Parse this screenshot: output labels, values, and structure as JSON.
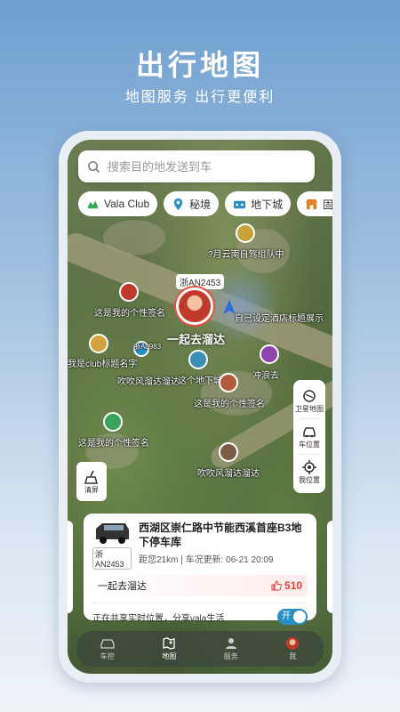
{
  "promo": {
    "title": "出行地图",
    "subtitle": "地图服务  出行更便利"
  },
  "search": {
    "placeholder": "搜索目的地发送到车"
  },
  "chips": [
    {
      "label": "Vala Club",
      "icon": "vala-club-icon",
      "color": "#2fa84f"
    },
    {
      "label": "秘境",
      "icon": "location-pin-icon",
      "color": "#2a8fc4"
    },
    {
      "label": "地下城",
      "icon": "underground-icon",
      "color": "#2a8fc4"
    },
    {
      "label": "固定",
      "icon": "store-icon",
      "color": "#e67e22"
    }
  ],
  "map": {
    "labels": [
      "?月云南自驾组队中",
      "这是我的个性签名",
      "一起去溜达",
      "自己设定酒店标题展示",
      "我是club标题名字",
      "吹吹风溜达溜达",
      "这个地下城",
      "冲浪去",
      "这是我的个性签名",
      "这是我的个性签名",
      "吹吹风溜达溜达"
    ],
    "plates": [
      "浙AN2453",
      "浙A0983"
    ],
    "main_ride_name": "一起去溜达"
  },
  "tools": {
    "satellite": "卫星地图",
    "car_location": "车位置",
    "my_location": "我位置",
    "clear": "清屏"
  },
  "card": {
    "address": "西湖区崇仁路中节能西溪首座B3地下停车库",
    "plate": "浙AN2453",
    "meta": "距您21km | 车况更新: 06-21 20:09",
    "ride_title": "一起去溜达",
    "likes": "510",
    "share_text": "正在共享实时位置，分享vala生活",
    "toggle_label": "开",
    "accent": "#e0413a"
  },
  "tabs": [
    {
      "label": "车控",
      "icon": "car-control-icon"
    },
    {
      "label": "地图",
      "icon": "map-icon"
    },
    {
      "label": "服务",
      "icon": "service-icon"
    },
    {
      "label": "我",
      "icon": "me-avatar-icon"
    }
  ]
}
